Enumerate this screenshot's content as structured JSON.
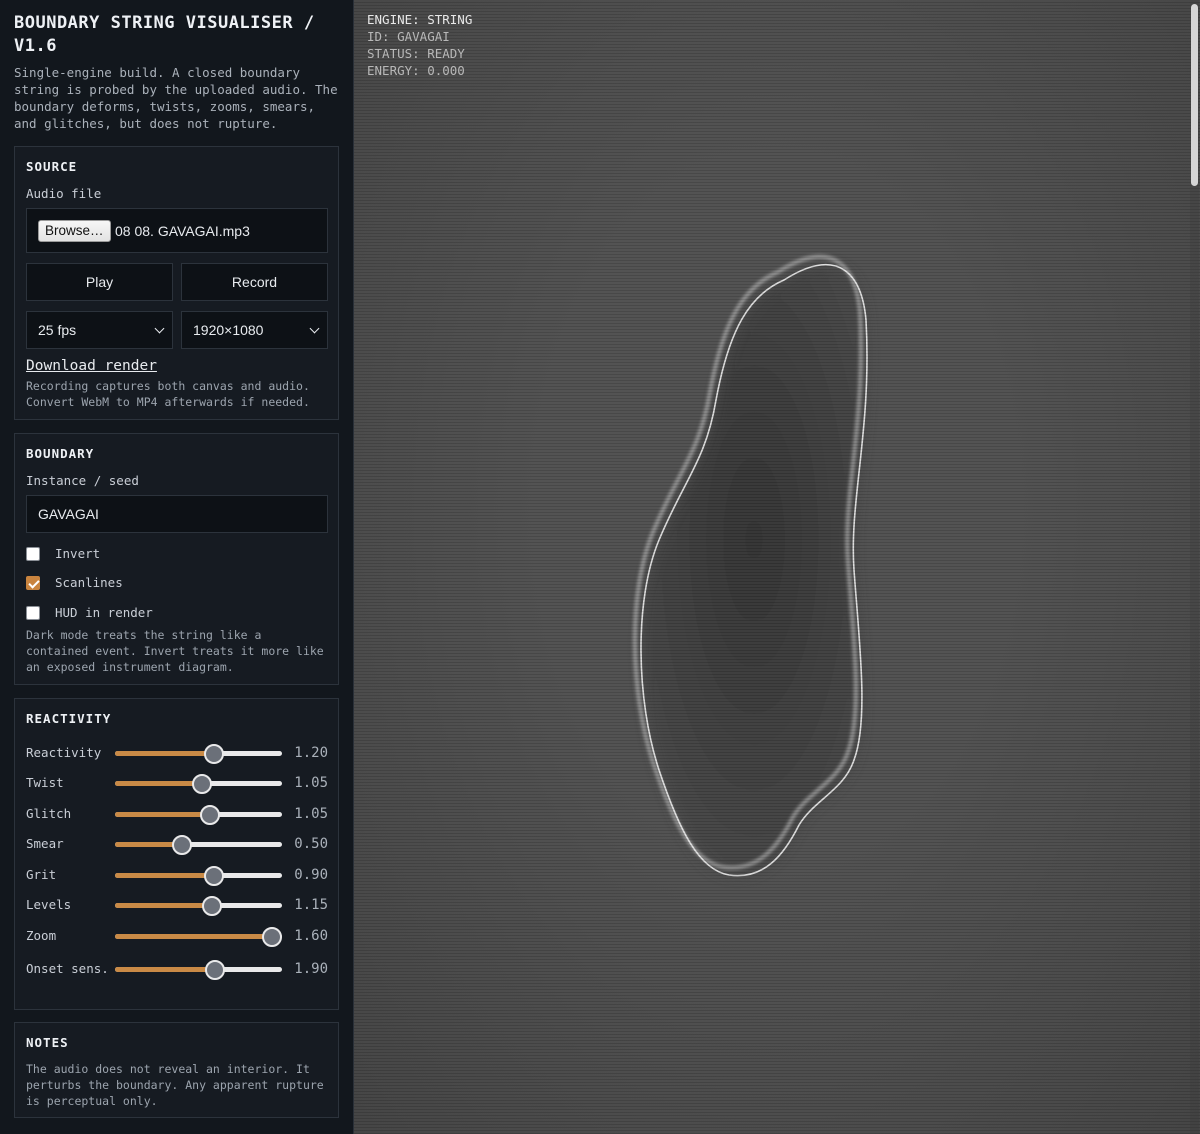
{
  "header": {
    "title": "BOUNDARY STRING VISUALISER / V1.6",
    "subtitle": "Single-engine build. A closed boundary string is probed by the uploaded audio. The boundary deforms, twists, zooms, smears, and glitches, but does not rupture."
  },
  "source": {
    "title": "SOURCE",
    "audio_label": "Audio file",
    "browse_label": "Browse…",
    "file_name": "08 08. GAVAGAI.mp3",
    "play_label": "Play",
    "record_label": "Record",
    "fps_value": "25 fps",
    "resolution_value": "1920×1080",
    "download_label": "Download render",
    "note": "Recording captures both canvas and audio. Convert WebM to MP4 afterwards if needed."
  },
  "boundary": {
    "title": "BOUNDARY",
    "seed_label": "Instance / seed",
    "seed_value": "GAVAGAI",
    "checks": [
      {
        "label": "Invert",
        "checked": false
      },
      {
        "label": "Scanlines",
        "checked": true
      },
      {
        "label": "HUD in render",
        "checked": false
      }
    ],
    "note": "Dark mode treats the string like a contained event. Invert treats it more like an exposed instrument diagram."
  },
  "reactivity": {
    "title": "REACTIVITY",
    "sliders": [
      {
        "label": "Reactivity",
        "value": "1.20",
        "level": 0.59
      },
      {
        "label": "Twist",
        "value": "1.05",
        "level": 0.52
      },
      {
        "label": "Glitch",
        "value": "1.05",
        "level": 0.57
      },
      {
        "label": "Smear",
        "value": "0.50",
        "level": 0.4
      },
      {
        "label": "Grit",
        "value": "0.90",
        "level": 0.59
      },
      {
        "label": "Levels",
        "value": "1.15",
        "level": 0.58
      },
      {
        "label": "Zoom",
        "value": "1.60",
        "level": 0.94
      },
      {
        "label": "Onset sens.",
        "value": "1.90",
        "level": 0.6
      }
    ]
  },
  "notes": {
    "title": "NOTES",
    "text": "The audio does not reveal an interior. It perturbs the boundary. Any apparent rupture is perceptual only."
  },
  "hud": {
    "engine": "ENGINE: STRING",
    "id": "ID: GAVAGAI",
    "status": "STATUS: READY",
    "energy": "ENERGY: 0.000"
  },
  "colors": {
    "accent": "#c98a46",
    "stage": "#505050",
    "sidebar": "#12171d"
  }
}
